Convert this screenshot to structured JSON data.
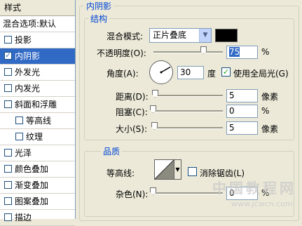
{
  "left_panel": {
    "header": "样式",
    "blend_options": "混合选项:默认",
    "items": [
      {
        "label": "投影",
        "checked": false
      },
      {
        "label": "内阴影",
        "checked": true
      },
      {
        "label": "外发光",
        "checked": false
      },
      {
        "label": "内发光",
        "checked": false
      },
      {
        "label": "斜面和浮雕",
        "checked": false
      },
      {
        "label": "等高线",
        "checked": false
      },
      {
        "label": "纹理",
        "checked": false
      },
      {
        "label": "光泽",
        "checked": false
      },
      {
        "label": "颜色叠加",
        "checked": false
      },
      {
        "label": "渐变叠加",
        "checked": false
      },
      {
        "label": "图案叠加",
        "checked": false
      },
      {
        "label": "描边",
        "checked": false
      }
    ]
  },
  "inner_shadow": {
    "group_title": "内阴影",
    "structure": {
      "title": "结构",
      "blend_mode_label": "混合模式:",
      "blend_mode_value": "正片叠底",
      "shadow_color": "#000000",
      "opacity_label": "不透明度(O):",
      "opacity_value": "75",
      "opacity_unit": "%",
      "angle_label": "角度(A):",
      "angle_value": "30",
      "angle_unit": "度",
      "global_light_label": "使用全局光(G)",
      "global_light_checked": true,
      "distance_label": "距离(D):",
      "distance_value": "5",
      "distance_unit": "像素",
      "choke_label": "阻塞(C):",
      "choke_value": "0",
      "choke_unit": "%",
      "size_label": "大小(S):",
      "size_value": "5",
      "size_unit": "像素"
    },
    "quality": {
      "title": "品质",
      "contour_label": "等高线:",
      "anti_alias_label": "消除锯齿(L)",
      "anti_alias_checked": false,
      "noise_label": "杂色(N):",
      "noise_value": "0",
      "noise_unit": "%"
    }
  },
  "watermark": {
    "text": "中国教程网",
    "url": "www.jcwcn.com"
  }
}
